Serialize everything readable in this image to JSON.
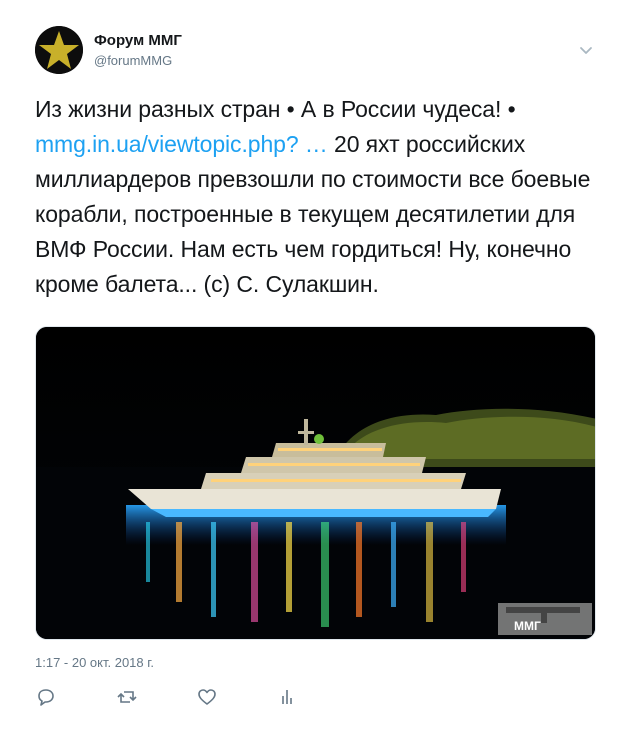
{
  "author": {
    "name": "Форум ММГ",
    "handle": "@forumMMG",
    "avatar_icon": "star-icon"
  },
  "tweet": {
    "text_part1": "Из жизни разных стран • А в России чудеса! • ",
    "link": "mmg.in.ua/viewtopic.php? …",
    "text_part2": " 20 яхт российских миллиардеров превзошли по стоимости все боевые корабли, построенные в текущем десятилетии для ВМФ России. Нам есть чем гордиться! Ну, конечно кроме балета... (с) С. Сулакшин."
  },
  "media": {
    "watermark": "ММГ"
  },
  "timestamp": "1:17 - 20 окт. 2018 г.",
  "actions": [
    {
      "name": "reply",
      "icon": "reply-icon"
    },
    {
      "name": "retweet",
      "icon": "retweet-icon"
    },
    {
      "name": "like",
      "icon": "heart-icon"
    },
    {
      "name": "analytics",
      "icon": "analytics-icon"
    }
  ],
  "colors": {
    "link": "#1da1f2",
    "text": "#14171a",
    "muted": "#657786",
    "star": "#c8b02a"
  }
}
